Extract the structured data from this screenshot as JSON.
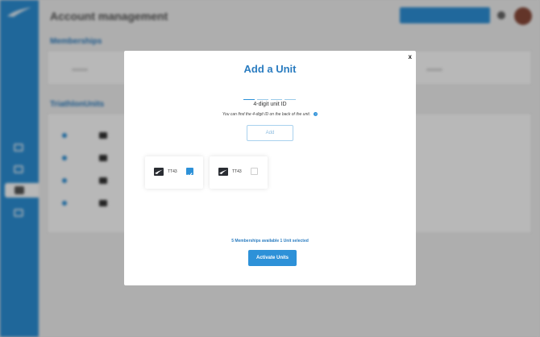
{
  "modal": {
    "title": "Add a Unit",
    "close_label": "x",
    "unit_id_label": "4-digit unit ID",
    "hint": "You can find the 4-digit ID on the back of the unit.",
    "add_label": "Add",
    "status": "5 Memberships available 1 Unit selected",
    "activate_label": "Activate Units",
    "units": [
      {
        "label": "TT43",
        "selected": true
      },
      {
        "label": "TT43",
        "selected": false
      }
    ]
  },
  "background": {
    "title": "Account management",
    "section_memberships": "Memberships",
    "section_units": "TriathlonUnits"
  },
  "colors": {
    "accent": "#2d91d8",
    "sidebar": "#2b8fd6",
    "title_text": "#2a7cc0"
  }
}
